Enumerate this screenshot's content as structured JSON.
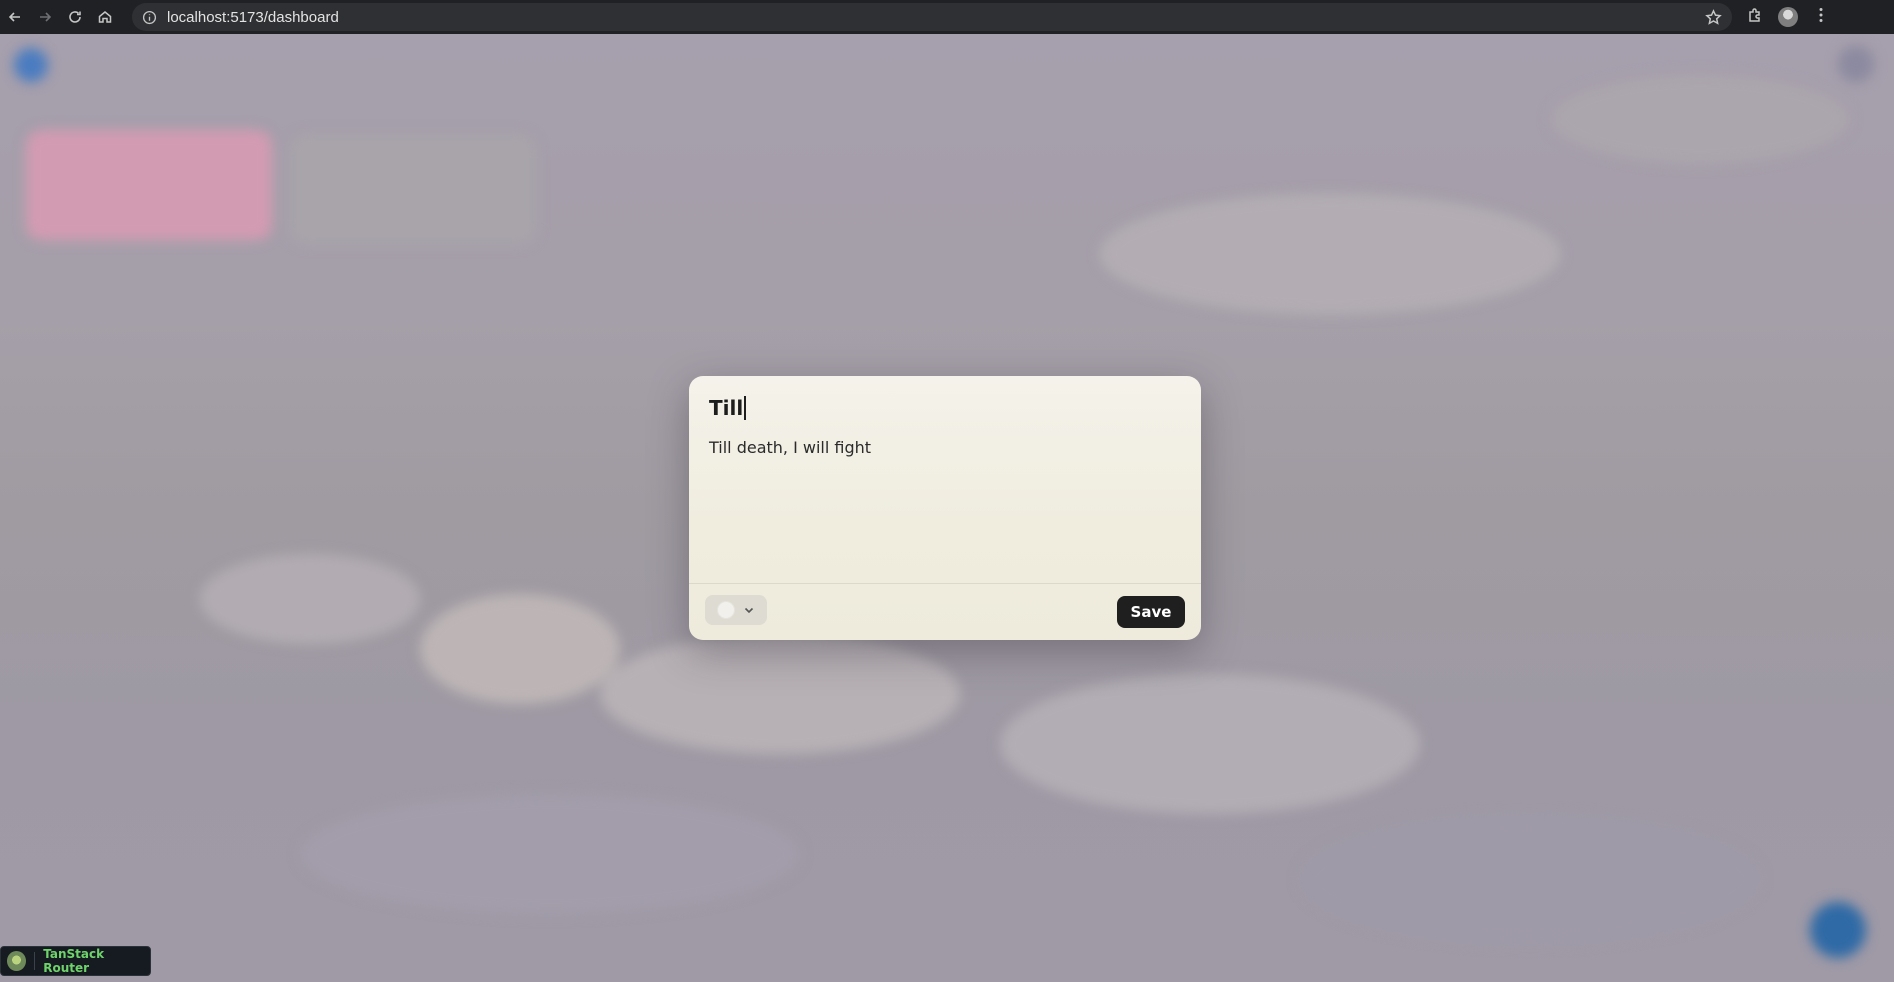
{
  "browser": {
    "url": "localhost:5173/dashboard"
  },
  "app": {
    "brand": "",
    "brand_sub": "",
    "cards": [
      {
        "title": "",
        "text": ""
      },
      {
        "title": "",
        "text": ""
      }
    ]
  },
  "dialog": {
    "title": "Till",
    "body": "Till death, I will fight",
    "color_picker_value": "#f1f0ec",
    "save_label": "Save"
  },
  "devtools": {
    "label": "TanStack Router"
  },
  "colors": {
    "overlay": "#9d96a0",
    "save_button": "#1f1f1f",
    "tanstack_text": "#6fd36b",
    "pink_card": "#d39bb2",
    "fab": "#2f6aa6"
  },
  "icons": [
    "back-icon",
    "forward-icon",
    "reload-icon",
    "home-icon",
    "site-info-icon",
    "star-icon",
    "extensions-icon",
    "profile-avatar",
    "menu-dots-icon",
    "chevron-down-icon"
  ]
}
